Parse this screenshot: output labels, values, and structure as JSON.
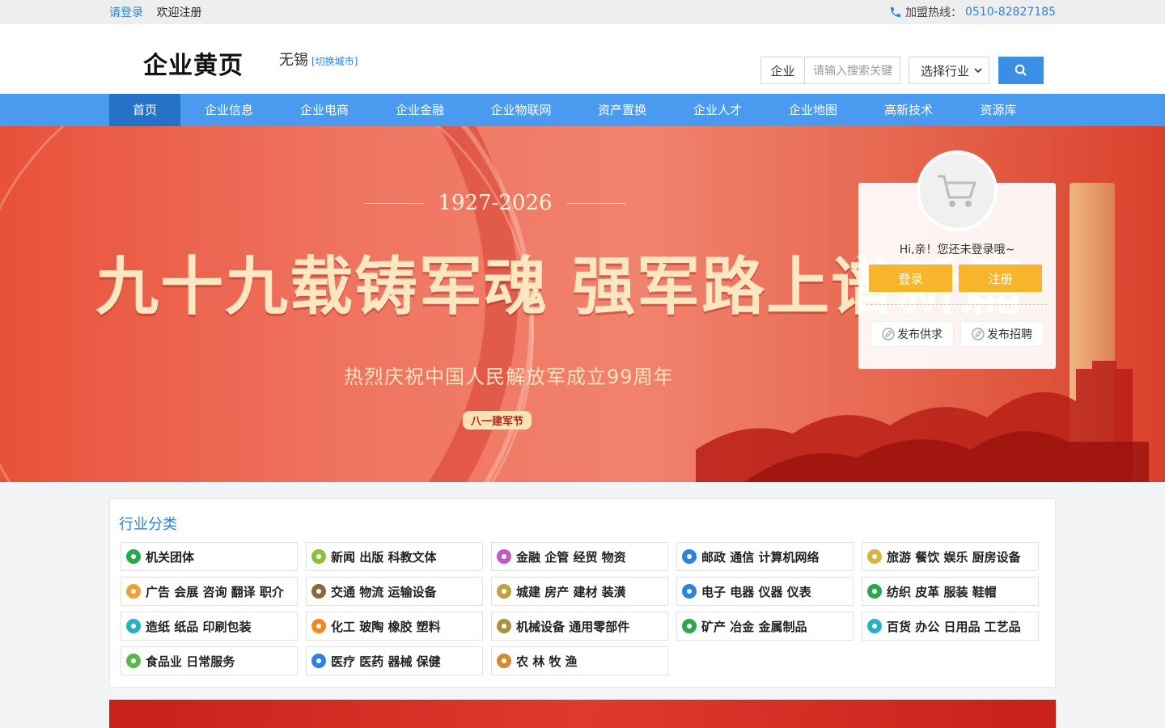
{
  "topbar": {
    "login": "请登录",
    "register": "欢迎注册",
    "hotline_label": "加盟热线：",
    "hotline_number": "0510-82827185"
  },
  "header": {
    "logo": "企业黄页",
    "city": "无锡",
    "switch_city": "[切换城市]",
    "search_type": "企业",
    "search_placeholder": "请输入搜索关键",
    "industry_select": "选择行业"
  },
  "nav": [
    {
      "label": "首页",
      "active": true
    },
    {
      "label": "企业信息"
    },
    {
      "label": "企业电商"
    },
    {
      "label": "企业金融"
    },
    {
      "label": "企业物联网"
    },
    {
      "label": "资产置换"
    },
    {
      "label": "企业人才"
    },
    {
      "label": "企业地图"
    },
    {
      "label": "高新技术"
    },
    {
      "label": "资源库"
    }
  ],
  "banner": {
    "years": "1927-2026",
    "headline": "九十九载铸军魂 强军路上谱新篇",
    "subtitle": "热烈庆祝中国人民解放军成立99周年",
    "badge": "八一建军节"
  },
  "login_card": {
    "greeting": "Hi,亲！您还未登录哦~",
    "login_button": "登录",
    "register_button": "注册",
    "post_supply": "发布供求",
    "post_job": "发布招聘"
  },
  "categories": {
    "title": "行业分类",
    "items": [
      {
        "label": "机关团体",
        "icon": "star-icon",
        "color": "#2aa84a"
      },
      {
        "label": "新闻 出版 科教文体",
        "icon": "pen-icon",
        "color": "#8cbf3a"
      },
      {
        "label": "金融 企管 经贸 物资",
        "icon": "coin-icon",
        "color": "#c05cc8"
      },
      {
        "label": "邮政 通信 计算机网络",
        "icon": "computer-icon",
        "color": "#2b82e0"
      },
      {
        "label": "旅游 餐饮 娱乐 厨房设备",
        "icon": "palm-icon",
        "color": "#d9b43a"
      },
      {
        "label": "广告 会展 咨询 翻译 职介",
        "icon": "megaphone-icon",
        "color": "#f0a030"
      },
      {
        "label": "交通 物流 运输设备",
        "icon": "truck-icon",
        "color": "#8a6a3a"
      },
      {
        "label": "城建 房产 建材 装潢",
        "icon": "house-icon",
        "color": "#c0a040"
      },
      {
        "label": "电子 电器 仪器 仪表",
        "icon": "rocket-icon",
        "color": "#2b82e0"
      },
      {
        "label": "纺织 皮革 服装 鞋帽",
        "icon": "shirt-icon",
        "color": "#2aa84a"
      },
      {
        "label": "造纸 纸品 印刷包装",
        "icon": "paper-icon",
        "color": "#2ab0c0"
      },
      {
        "label": "化工 玻陶 橡胶 塑料",
        "icon": "flask-icon",
        "color": "#f08a20"
      },
      {
        "label": "机械设备 通用零部件",
        "icon": "gear-icon",
        "color": "#b09040"
      },
      {
        "label": "矿产 冶金 金属制品",
        "icon": "ore-icon",
        "color": "#2aa84a"
      },
      {
        "label": "百货 办公 日用品 工艺品",
        "icon": "umbrella-icon",
        "color": "#2ab0c0"
      },
      {
        "label": "食品业 日常服务",
        "icon": "leaf-icon",
        "color": "#5ab84a"
      },
      {
        "label": "医疗 医药 器械 保健",
        "icon": "cross-icon",
        "color": "#2b82e0"
      },
      {
        "label": "农 林 牧 渔",
        "icon": "wheat-icon",
        "color": "#d08a30"
      }
    ]
  }
}
